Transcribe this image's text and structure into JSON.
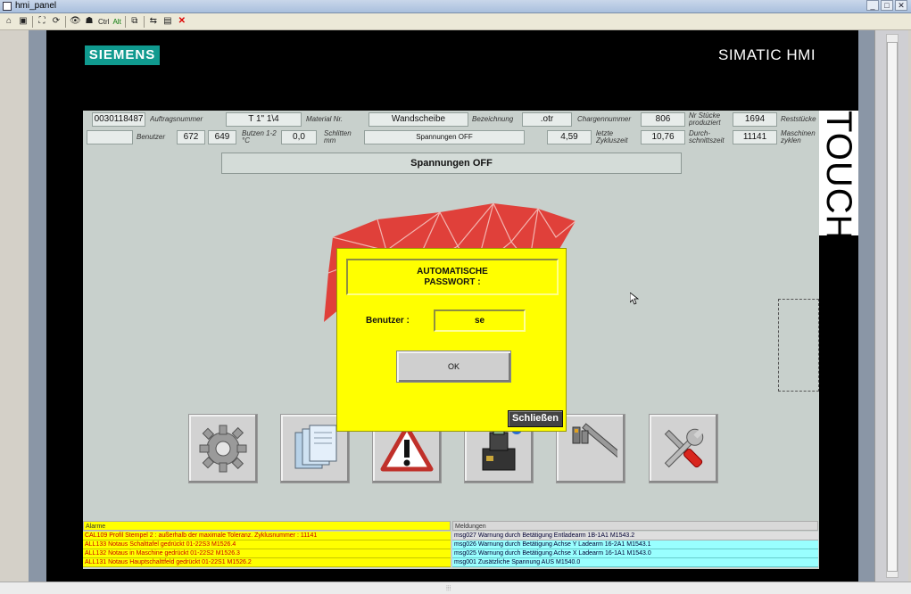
{
  "window": {
    "title": "hmi_panel"
  },
  "toolbar": {
    "ctrl_label": "Ctrl",
    "alt_label": "Alt"
  },
  "brand": {
    "logo": "SIEMENS",
    "product": "SIMATIC HMI",
    "touch": "TOUCH"
  },
  "header": {
    "row1": {
      "auftragsnummer": "0030118487",
      "auftragsnummer_lbl": "Auftragsnummer",
      "material": "T  1\" 1\\4",
      "material_lbl": "Material Nr.",
      "bezeichnung": "Wandscheibe",
      "bezeichnung_lbl": "Bezeichnung",
      "charge": ".otr",
      "charge_lbl": "Chargennummer",
      "produziert": "806",
      "produziert_lbl": "Nr Stücke produziert",
      "rest": "1694",
      "rest_lbl": "Reststücke"
    },
    "row2": {
      "benutzer": "",
      "benutzer_lbl": "Benutzer",
      "butzen1": "672",
      "butzen2": "649",
      "butzen_lbl": "Butzen 1-2 °C",
      "schlitten": "0,0",
      "schlitten_lbl": "Schlitten mm",
      "spannung": "Spannungen OFF",
      "zykluszeit": "4,59",
      "zykluszeit_lbl": "letzte Zykluszeit",
      "durchschnitt": "10,76",
      "durchschnitt_lbl": "Durch-schnittszeit",
      "maschinen": "11141",
      "maschinen_lbl": "Maschinen zyklen"
    }
  },
  "status_banner": "Spannungen OFF",
  "dialog": {
    "title_line1": "AUTOMATISCHE",
    "title_line2": "PASSWORT :",
    "user_label": "Benutzer :",
    "user_value": "se",
    "ok_label": "OK",
    "close_label": "Schließen"
  },
  "nav_buttons": [
    "gear-icon",
    "manual-icon",
    "warning-icon",
    "machine-icon",
    "caliper-icon",
    "tools-icon"
  ],
  "alarms": {
    "header": "Alarme",
    "rows": [
      "CAL109 Profil Stempel 2 : außerhalb der maximale Toleranz.  Zyklusnummer : 11141",
      "ALL133 Notaus Schalttafel gedrückt  01-22S3   M1526.4",
      "ALL132 Notaus in Maschine gedrückt 01-22S2   M1526.3",
      "ALL131 Notaus Hauptschalttfeld gedrückt   01-22S1   M1526.2"
    ]
  },
  "messages": {
    "header": "Meldungen",
    "rows": [
      "msg027 Warnung durch Betätigung Entladearm 1B-1A1    M1543.2",
      "msg026 Warnung durch Betätigung Achse Y Ladearm 16-2A1      M1543.1",
      "msg025 Warnung durch Betätigung Achse X Ladearm 16-1A1      M1543.0",
      "msg001 Zusätzliche Spannung AUS  M1540.0"
    ]
  },
  "colors": {
    "dialog_bg": "#ffff00",
    "logo_red": "#e0403a",
    "siemens_teal": "#109a8f"
  }
}
